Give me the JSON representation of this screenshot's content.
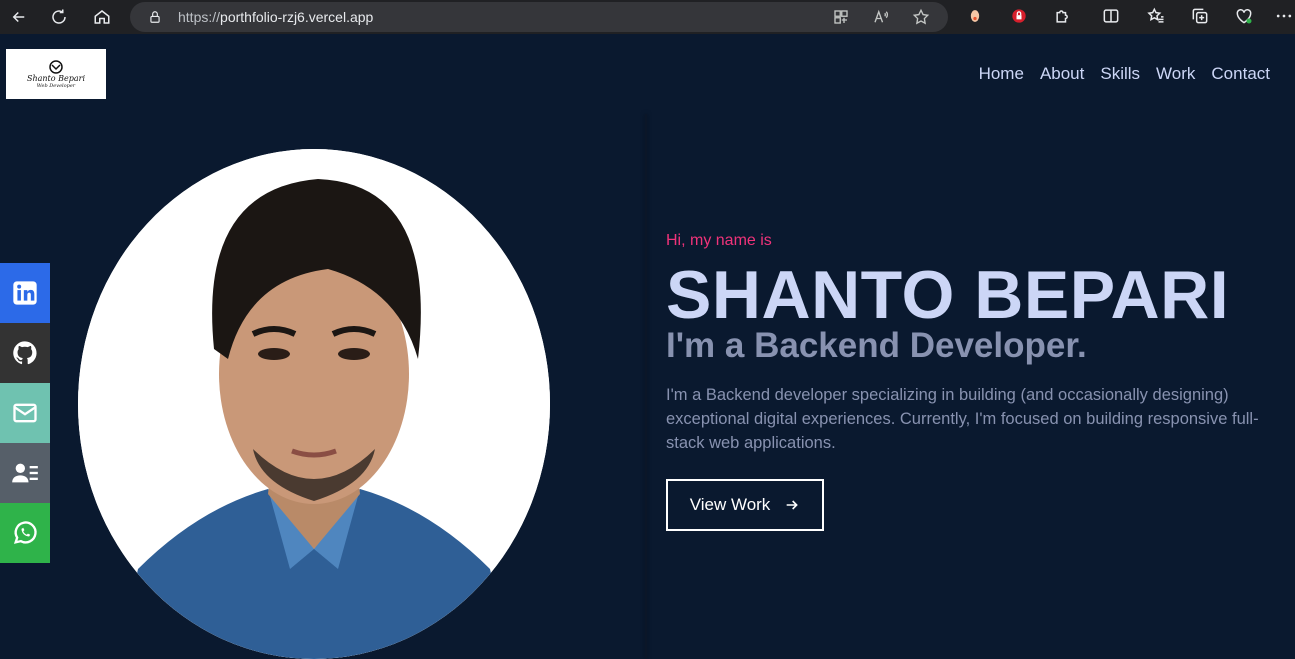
{
  "browser": {
    "url_prefix": "https://",
    "url_host": "porthfolio-rzj6.vercel.app"
  },
  "site": {
    "logo": {
      "name": "Shanto Bepari",
      "subtitle": "Web Developer"
    },
    "nav": [
      "Home",
      "About",
      "Skills",
      "Work",
      "Contact"
    ],
    "hero": {
      "greeting": "Hi, my name is",
      "name": "SHANTO BEPARI",
      "role": "I'm a Backend Developer.",
      "description": "I'm a Backend developer specializing in building (and occasionally designing) exceptional digital experiences. Currently, I'm focused on building responsive full-stack web applications.",
      "cta_label": "View Work"
    },
    "social": [
      {
        "icon": "linkedin-icon",
        "color": "#2c6ae8"
      },
      {
        "icon": "github-icon",
        "color": "#333333"
      },
      {
        "icon": "mail-icon",
        "color": "#6fc2b0"
      },
      {
        "icon": "resume-icon",
        "color": "#565f69"
      },
      {
        "icon": "whatsapp-icon",
        "color": "#2fb34a"
      }
    ]
  },
  "colors": {
    "bg": "#0a192f",
    "accent": "#f0337a",
    "heading": "#ccd6f6",
    "muted": "#8892b0"
  }
}
